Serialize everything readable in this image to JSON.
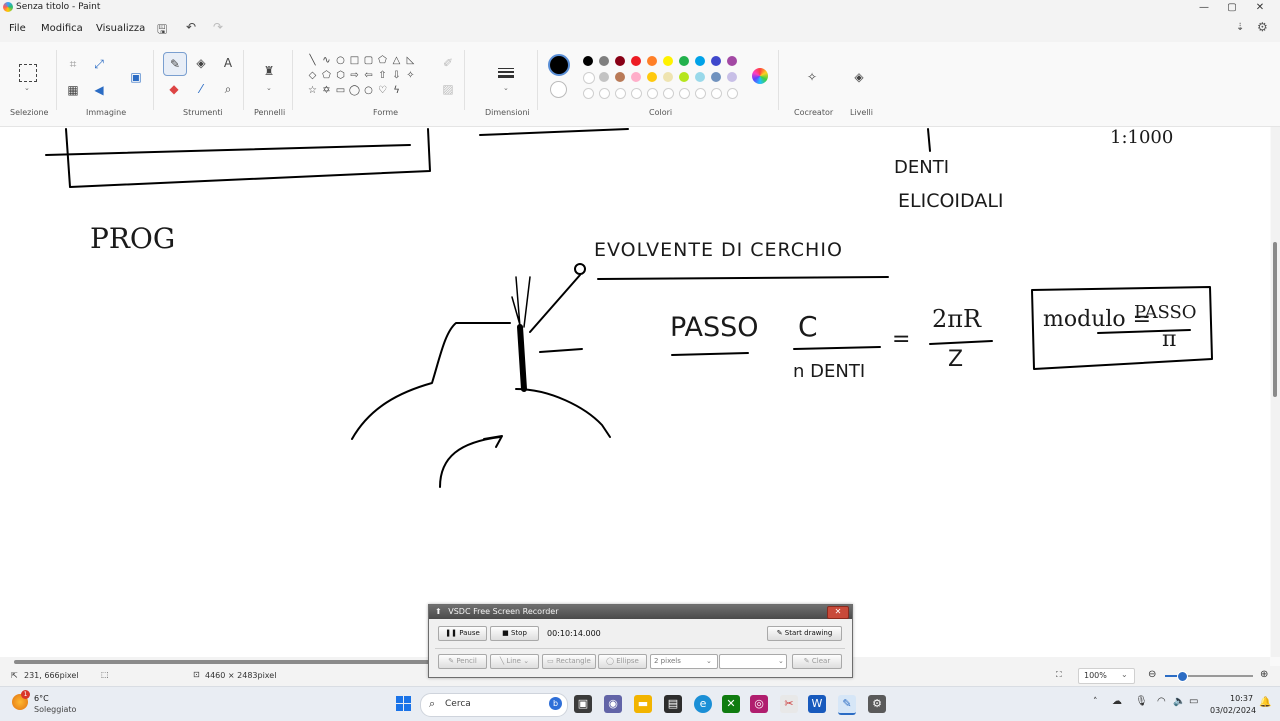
{
  "window": {
    "title": "Senza titolo - Paint",
    "controls": {
      "minimize": "—",
      "maximize": "▢",
      "close": "✕"
    }
  },
  "menu": {
    "file": "File",
    "modifica": "Modifica",
    "visualizza": "Visualizza"
  },
  "ribbon": {
    "groups": {
      "selezione": "Selezione",
      "immagine": "Immagine",
      "strumenti": "Strumenti",
      "pennelli": "Pennelli",
      "forme": "Forme",
      "dimensioni": "Dimensioni",
      "colori": "Colori",
      "cocreator": "Cocreator",
      "livelli": "Livelli"
    },
    "palette_row1": [
      "#000000",
      "#7f7f7f",
      "#880015",
      "#ed1c24",
      "#ff7f27",
      "#fff200",
      "#22b14c",
      "#00a2e8",
      "#3f48cc",
      "#a349a4"
    ],
    "palette_row2": [
      "#ffffff",
      "#c3c3c3",
      "#b97a57",
      "#ffaec9",
      "#ffc90e",
      "#efe4b0",
      "#b5e61d",
      "#99d9ea",
      "#7092be",
      "#c8bfe7"
    ],
    "palette_row3_empty": 10,
    "active_color": "#000000"
  },
  "canvas": {
    "handwriting": {
      "prog": "PROG",
      "evolvente": "EVOLVENTE DI CERCHIO",
      "passo": "PASSO",
      "c": "C",
      "n_denti": "n DENTI",
      "equals": "=",
      "two_pi_r": "2πR",
      "z": "Z",
      "modulo": "modulo =",
      "modulo_passo": "PASSO",
      "pi": "π",
      "denti": "DENTI",
      "elicoidali": "ELICOIDALI",
      "scale": "1:1000"
    }
  },
  "status": {
    "cursor_pos": "231, 666pixel",
    "image_size": "4460 × 2483pixel",
    "zoom": "100%"
  },
  "recorder": {
    "title": "VSDC Free Screen Recorder",
    "pause": "Pause",
    "stop": "Stop",
    "time": "00:10:14.000",
    "start_drawing": "Start drawing",
    "pencil": "Pencil",
    "line": "Line",
    "rectangle": "Rectangle",
    "ellipse": "Ellipse",
    "size": "2 pixels",
    "clear": "Clear"
  },
  "taskbar": {
    "temperature": "6°C",
    "weather": "Soleggiato",
    "search_placeholder": "Cerca",
    "time": "10:37",
    "date": "03/02/2024",
    "badge": "1"
  }
}
